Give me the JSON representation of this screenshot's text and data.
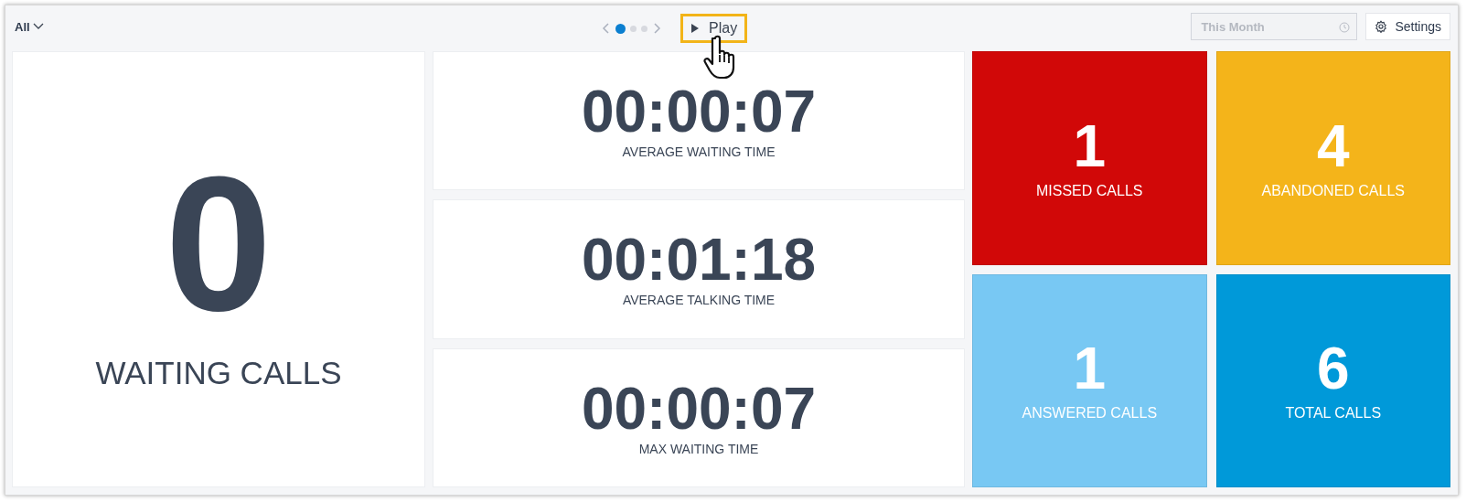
{
  "toolbar": {
    "filter": "All",
    "pager": [
      {
        "selected": true
      },
      {
        "selected": false
      },
      {
        "selected": false
      }
    ],
    "play": {
      "label": "Play",
      "highlighted": true
    },
    "date_field": {
      "placeholder": "This Month",
      "disabled": true
    },
    "settings": "Settings"
  },
  "waiting": {
    "value": "0",
    "label": "WAITING CALLS"
  },
  "times": [
    {
      "value": "00:00:07",
      "label": "AVERAGE WAITING TIME"
    },
    {
      "value": "00:01:18",
      "label": "AVERAGE TALKING TIME"
    },
    {
      "value": "00:00:07",
      "label": "MAX WAITING TIME"
    }
  ],
  "tiles": [
    {
      "value": "1",
      "label": "MISSED CALLS",
      "color": "#d10808"
    },
    {
      "value": "4",
      "label": "ABANDONED CALLS",
      "color": "#f4b41a"
    },
    {
      "value": "1",
      "label": "ANSWERED CALLS",
      "color": "#78c8f3"
    },
    {
      "value": "6",
      "label": "TOTAL CALLS",
      "color": "#0099d9"
    }
  ]
}
